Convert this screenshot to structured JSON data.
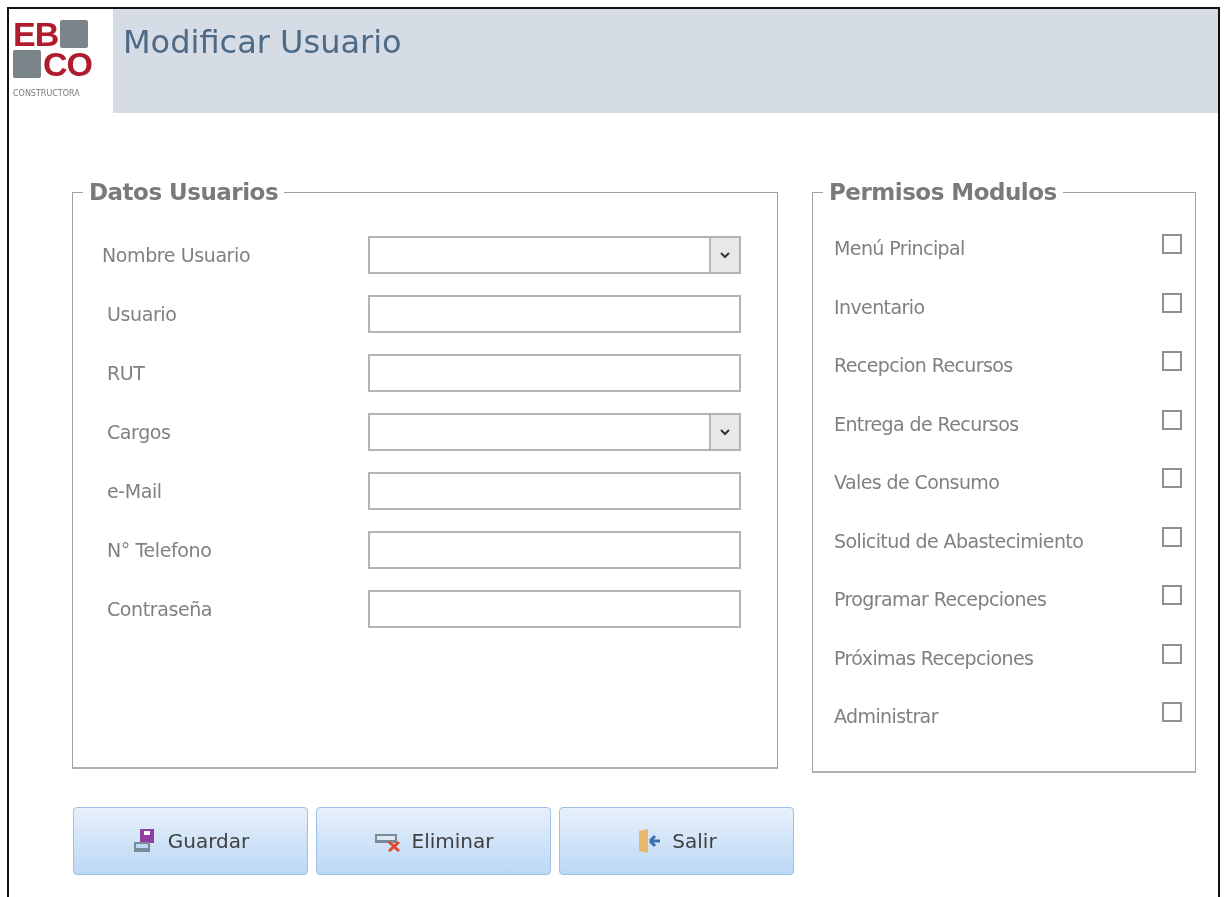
{
  "logo": {
    "line_1": "EB",
    "line_2": "CO",
    "tagline": "CONSTRUCTORA"
  },
  "header": {
    "title": "Modificar Usuario"
  },
  "user_data": {
    "legend": "Datos Usuarios",
    "fields": [
      {
        "label": "Nombre Usuario",
        "kind": "select"
      },
      {
        "label": "Usuario",
        "kind": "text"
      },
      {
        "label": "RUT",
        "kind": "text"
      },
      {
        "label": "Cargos",
        "kind": "select"
      },
      {
        "label": "e-Mail",
        "kind": "text"
      },
      {
        "label": "N° Telefono",
        "kind": "text"
      },
      {
        "label": "Contraseña",
        "kind": "text"
      }
    ]
  },
  "permissions": {
    "legend": "Permisos Modulos",
    "items": [
      {
        "label": "Menú Principal",
        "checked": false
      },
      {
        "label": "Inventario",
        "checked": false
      },
      {
        "label": "Recepcion Recursos",
        "checked": false
      },
      {
        "label": "Entrega de Recursos",
        "checked": false
      },
      {
        "label": "Vales de Consumo",
        "checked": false
      },
      {
        "label": "Solicitud de Abastecimiento",
        "checked": false
      },
      {
        "label": "Programar Recepciones",
        "checked": false
      },
      {
        "label": "Próximas Recepciones",
        "checked": false
      },
      {
        "label": "Administrar",
        "checked": false
      }
    ]
  },
  "buttons": [
    {
      "label": "Guardar",
      "kind": "save"
    },
    {
      "label": "Eliminar",
      "kind": "delete"
    },
    {
      "label": "Salir",
      "kind": "exit"
    }
  ]
}
